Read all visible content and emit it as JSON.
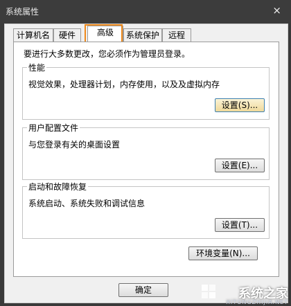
{
  "window": {
    "title": "系统属性",
    "close_label": "×"
  },
  "tabs": [
    {
      "label": "计算机名",
      "active": false
    },
    {
      "label": "硬件",
      "active": false
    },
    {
      "label": "高级",
      "active": true
    },
    {
      "label": "系统保护",
      "active": false
    },
    {
      "label": "远程",
      "active": false
    }
  ],
  "page": {
    "note": "要进行大多数更改，您必须作为管理员登录。",
    "groups": [
      {
        "legend": "性能",
        "description": "视觉效果，处理器计划，内存使用，以及及虚拟内存",
        "button": "设置(S)..."
      },
      {
        "legend": "用户配置文件",
        "description": "与您登录有关的桌面设置",
        "button": "设置(E)..."
      },
      {
        "legend": "启动和故障恢复",
        "description": "系统启动、系统失败和调试信息",
        "button": "设置(T)..."
      }
    ],
    "env_button": "环境变量(N)..."
  },
  "footer": {
    "ok": "确定"
  },
  "watermark": {
    "text": "系统之家",
    "sub": "XITONGZHIJIA.NET"
  },
  "colors": {
    "highlight": "#ef8a1b",
    "default_button": "#efd99a"
  }
}
